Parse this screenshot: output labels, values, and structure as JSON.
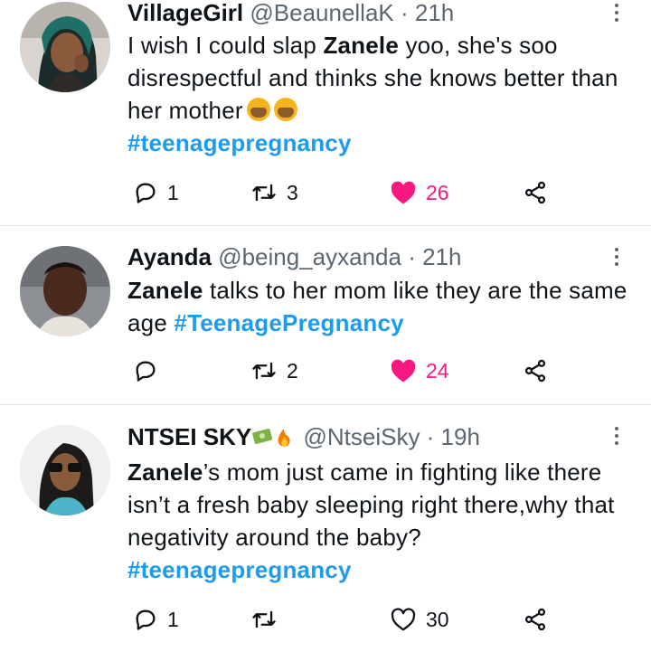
{
  "tweets": [
    {
      "name": "VillageGirl",
      "handle": "@BeaunellaK · 21h",
      "text_before": "I wish I could slap ",
      "bold": "Zanele",
      "text_after": " yoo, she's soo disrespectful and thinks she knows better than her mother",
      "emoji": "🤦‍♀️🤦‍♀️",
      "hashtag": "#teenagepregnancy",
      "replies": "1",
      "retweets": "3",
      "likes": "26",
      "liked": true
    },
    {
      "name": "Ayanda",
      "handle": "@being_ayxanda · 21h",
      "bold": "Zanele",
      "text_after": " talks to her mom like they are the same age ",
      "hashtag": "#TeenagePregnancy",
      "replies": "",
      "retweets": "2",
      "likes": "24",
      "liked": true
    },
    {
      "name": "NTSEI SKY",
      "name_emoji": "💸🔥",
      "handle": "@NtseiSky · 19h",
      "bold": "Zanele",
      "text_after": "’s mom just came in fighting like there isn’t a fresh baby sleeping right there,why that negativity around the baby?",
      "hashtag": "#teenagepregnancy",
      "replies": "1",
      "retweets": "",
      "likes": "30",
      "liked": false
    }
  ],
  "colors": {
    "hashtag": "#1d9bf0",
    "like_active": "#f91880",
    "icon_gray": "#5b6670",
    "divider": "#e3e6e9"
  },
  "icons": {
    "reply": "reply-icon",
    "retweet": "retweet-icon",
    "like": "heart-icon",
    "share": "share-icon",
    "more": "more-options-icon"
  }
}
